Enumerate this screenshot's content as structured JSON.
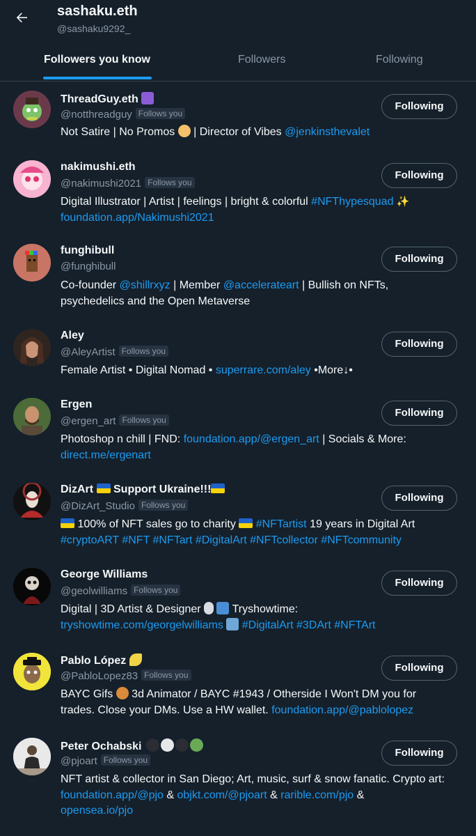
{
  "header": {
    "title": "sashaku.eth",
    "handle": "@sashaku9292_"
  },
  "tabs": [
    {
      "label": "Followers you know"
    },
    {
      "label": "Followers"
    },
    {
      "label": "Following"
    }
  ],
  "follows_you_label": "Follows you",
  "button_label": "Following",
  "colors": {
    "background": "#15202b",
    "accent": "#1d9bf0",
    "muted": "#8b98a5"
  },
  "users": [
    {
      "name": "ThreadGuy.eth",
      "handle": "@notthreadguy",
      "bio": [
        "Not Satire | No Promos ",
        " | Director of Vibes ",
        "@jenkinsthevalet"
      ]
    },
    {
      "name": "nakimushi.eth",
      "handle": "@nakimushi2021",
      "bio": [
        "Digital Illustrator | Artist | feelings | bright & colorful ",
        "#NFThypesquad",
        "foundation.app/Nakimushi2021"
      ]
    },
    {
      "name": "funghibull",
      "handle": "@funghibull",
      "bio": [
        "Co-founder ",
        "@shillrxyz",
        " | Member ",
        "@accelerateart",
        " | Bullish on NFTs, psychedelics and the Open Metaverse"
      ]
    },
    {
      "name": "Aley",
      "handle": "@AleyArtist",
      "bio": [
        "Female Artist • Digital Nomad • ",
        "superrare.com/aley",
        " •More↓•"
      ]
    },
    {
      "name": "Ergen",
      "handle": "@ergen_art",
      "bio": [
        "Photoshop n chill | FND: ",
        "foundation.app/@ergen_art",
        " | Socials & More: ",
        "direct.me/ergenart"
      ]
    },
    {
      "name": "DizArt ",
      "name_suffix": " Support Ukraine!!!",
      "handle": "@DizArt_Studio",
      "bio": [
        " 100% of NFT sales go to charity ",
        "#NFTartist",
        " 19 years in Digital Art ",
        "#cryptoART #NFT #NFTart #DigitalArt #NFTcollector #NFTcommunity"
      ]
    },
    {
      "name": "George Williams",
      "handle": "@geolwilliams",
      "bio": [
        "Digital | 3D Artist & Designer ",
        " Tryshowtime: ",
        "tryshowtime.com/georgelwilliams",
        "#DigitalArt #3DArt #NFTArt"
      ]
    },
    {
      "name": "Pablo López ",
      "handle": "@PabloLopez83",
      "bio": [
        "BAYC Gifs ",
        " 3d Animator / BAYC #1943 / Otherside I Won't DM you for trades. Close your DMs. Use a HW wallet. ",
        "foundation.app/@pablolopez"
      ]
    },
    {
      "name": "Peter Ochabski ",
      "handle": "@pjoart",
      "bio": [
        "NFT artist & collector in San Diego; Art, music, surf & snow fanatic. Crypto art: ",
        "foundation.app/@pjo",
        " & ",
        "objkt.com/@pjoart",
        " & ",
        "rarible.com/pjo",
        " & ",
        "opensea.io/pjo"
      ]
    }
  ]
}
